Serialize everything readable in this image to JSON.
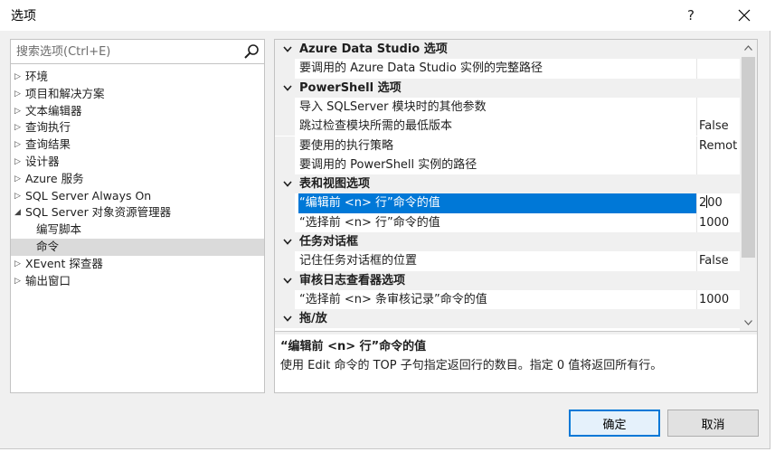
{
  "window": {
    "title": "选项",
    "help_label": "?",
    "close_icon": "close-icon"
  },
  "search": {
    "placeholder": "搜索选项(Ctrl+E)",
    "value": "",
    "icon": "search-icon"
  },
  "tree": [
    {
      "label": "环境",
      "expanded": false
    },
    {
      "label": "项目和解决方案",
      "expanded": false
    },
    {
      "label": "文本编辑器",
      "expanded": false
    },
    {
      "label": "查询执行",
      "expanded": false
    },
    {
      "label": "查询结果",
      "expanded": false
    },
    {
      "label": "设计器",
      "expanded": false
    },
    {
      "label": "Azure 服务",
      "expanded": false
    },
    {
      "label": "SQL Server Always On",
      "expanded": false
    },
    {
      "label": "SQL Server 对象资源管理器",
      "expanded": true
    },
    {
      "label": "编写脚本",
      "child": true
    },
    {
      "label": "命令",
      "child": true,
      "selected": true
    },
    {
      "label": "XEvent 探查器",
      "expanded": false
    },
    {
      "label": "输出窗口",
      "expanded": false
    }
  ],
  "grid": {
    "rows": [
      {
        "type": "category",
        "label": "Azure Data Studio 选项"
      },
      {
        "type": "property",
        "name": "要调用的 Azure Data Studio 实例的完整路径",
        "value": ""
      },
      {
        "type": "category",
        "label": "PowerShell 选项"
      },
      {
        "type": "property",
        "name": "导入 SQLServer 模块时的其他参数",
        "value": ""
      },
      {
        "type": "property",
        "name": "跳过检查模块所需的最低版本",
        "value": "False"
      },
      {
        "type": "property",
        "name": "要使用的执行策略",
        "value": "Remot"
      },
      {
        "type": "property",
        "name": "要调用的 PowerShell 实例的路径",
        "value": ""
      },
      {
        "type": "category",
        "label": "表和视图选项"
      },
      {
        "type": "property",
        "name": "“编辑前 <n> 行”命令的值",
        "value": "200",
        "selected": true,
        "value_before_caret": "2",
        "value_after_caret": "00"
      },
      {
        "type": "property",
        "name": "“选择前 <n> 行”命令的值",
        "value": "1000"
      },
      {
        "type": "category",
        "label": "任务对话框"
      },
      {
        "type": "property",
        "name": "记住任务对话框的位置",
        "value": "False"
      },
      {
        "type": "category",
        "label": "审核日志查看器选项"
      },
      {
        "type": "property",
        "name": "“选择前 <n> 条审核记录”命令的值",
        "value": "1000"
      },
      {
        "type": "category",
        "label": "拖/放"
      }
    ]
  },
  "description": {
    "title": "“编辑前 <n> 行”命令的值",
    "text": "使用 Edit 命令的 TOP 子句指定返回行的数目。指定 0 值将返回所有行。"
  },
  "buttons": {
    "ok": "确定",
    "cancel": "取消"
  },
  "colors": {
    "selection": "#0078d7",
    "tree_selection": "#dadada",
    "category_bg": "#f0f0f0"
  }
}
